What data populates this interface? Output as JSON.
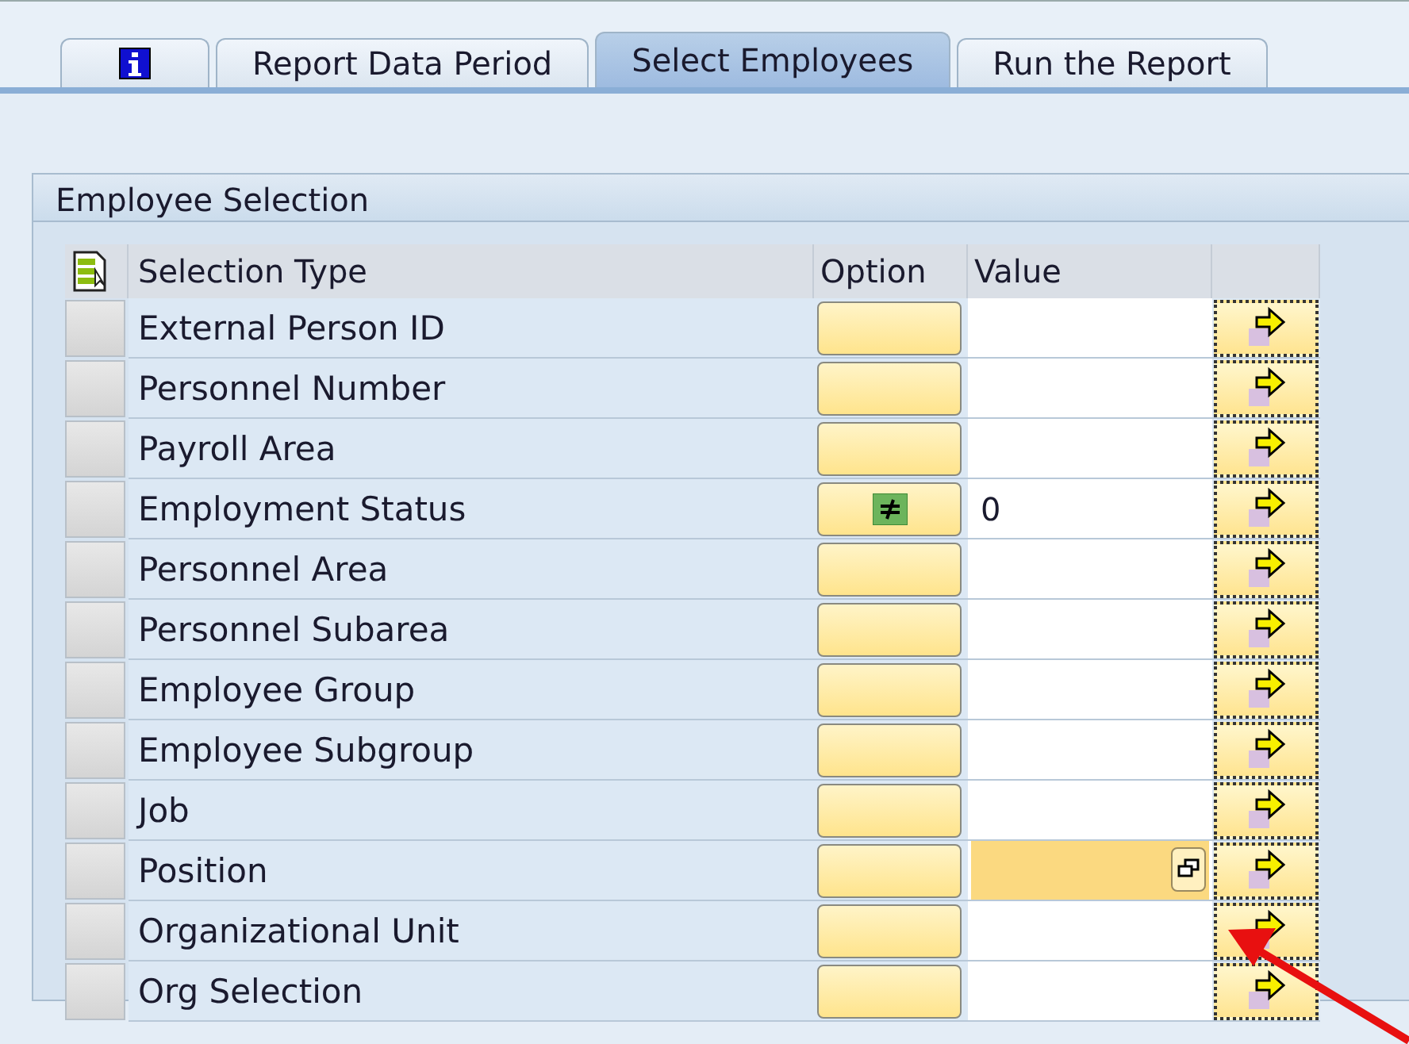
{
  "tabs": [
    {
      "kind": "info",
      "selected": false
    },
    {
      "kind": "text",
      "label": "Report Data Period",
      "selected": false
    },
    {
      "kind": "text",
      "label": "Select Employees",
      "selected": true
    },
    {
      "kind": "text",
      "label": "Run the Report",
      "selected": false
    }
  ],
  "panel": {
    "title": "Employee Selection",
    "columns": [
      "Selection Type",
      "Option",
      "Value"
    ],
    "rows": [
      {
        "type": "External Person ID",
        "kind": "blank",
        "value": "",
        "focused": false
      },
      {
        "type": "Personnel Number",
        "kind": "blank",
        "value": "",
        "focused": false
      },
      {
        "type": "Payroll Area",
        "kind": "blank",
        "value": "",
        "focused": false
      },
      {
        "type": "Employment Status",
        "kind": "not_equal",
        "value": "0",
        "focused": false
      },
      {
        "type": "Personnel Area",
        "kind": "blank",
        "value": "",
        "focused": false
      },
      {
        "type": "Personnel Subarea",
        "kind": "blank",
        "value": "",
        "focused": false
      },
      {
        "type": "Employee Group",
        "kind": "blank",
        "value": "",
        "focused": false
      },
      {
        "type": "Employee Subgroup",
        "kind": "blank",
        "value": "",
        "focused": false
      },
      {
        "type": "Job",
        "kind": "blank",
        "value": "",
        "focused": false
      },
      {
        "type": "Position",
        "kind": "blank",
        "value": "",
        "focused": true
      },
      {
        "type": "Organizational Unit",
        "kind": "blank",
        "value": "",
        "focused": false
      },
      {
        "type": "Org Selection",
        "kind": "blank",
        "value": "",
        "focused": false
      }
    ]
  },
  "annotation": {
    "kind": "arrow"
  }
}
